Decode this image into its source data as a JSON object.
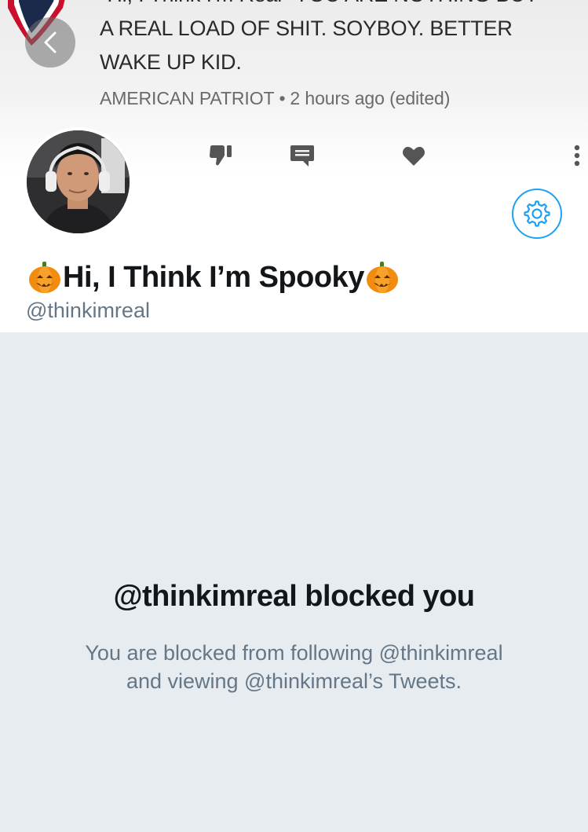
{
  "banner": {
    "comment_lines": [
      "\"Hi, I Think I'm Real\" YOU ARE NOTHING BUT",
      "A REAL LOAD OF SHIT. SOYBOY. BETTER",
      "WAKE UP KID."
    ],
    "author": "AMERICAN PATRIOT",
    "separator": "•",
    "timestamp": "2 hours ago (edited)",
    "icons": [
      "back-icon",
      "thumbs-down-icon",
      "comment-icon",
      "heart-icon",
      "more-vertical-icon"
    ]
  },
  "profile": {
    "display_name": "Hi, I Think I’m Spooky",
    "name_emoji": "pumpkin",
    "handle": "@thinkimreal",
    "settings_icon": "gear-icon"
  },
  "blocked": {
    "title": "@thinkimreal blocked you",
    "line1": "You are blocked from following @thinkimreal",
    "line2": "and viewing @thinkimreal’s Tweets."
  },
  "colors": {
    "accent": "#1da1f2",
    "background": "#e6ecf0",
    "text_primary": "#14171a",
    "text_secondary": "#657786"
  }
}
